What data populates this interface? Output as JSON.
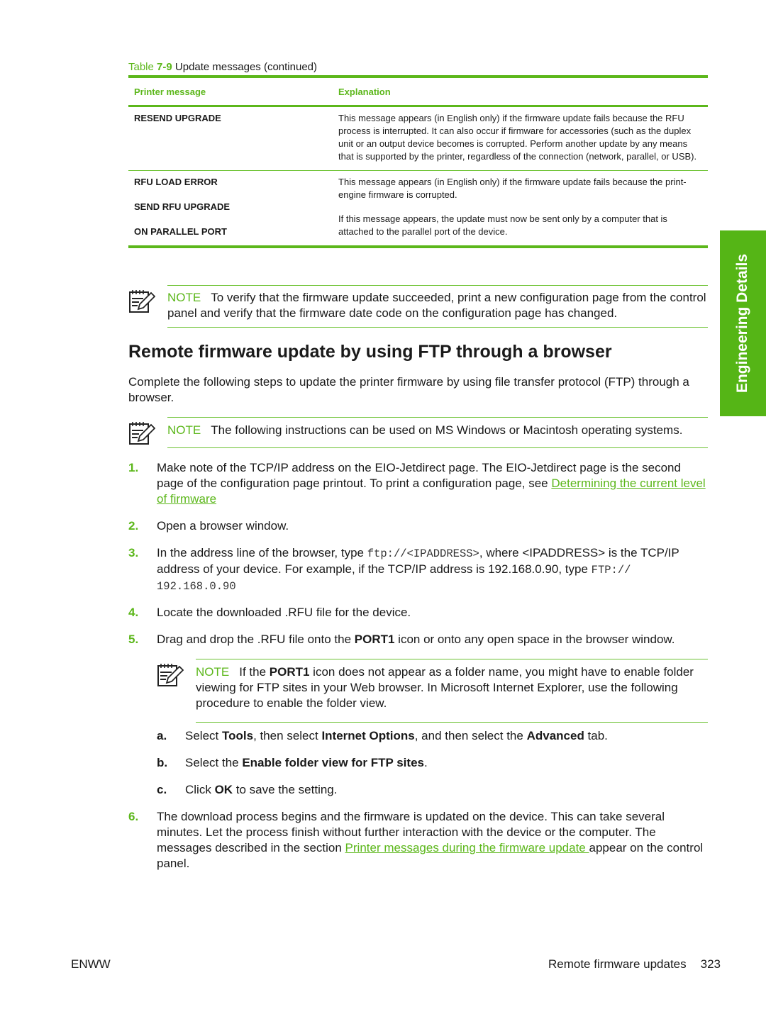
{
  "table": {
    "caption_prefix": "Table ",
    "caption_number": "7-9",
    "caption_text": "Update messages (continued)",
    "headers": [
      "Printer message",
      "Explanation"
    ],
    "rows": [
      {
        "messages": [
          "RESEND UPGRADE"
        ],
        "explanation": "This message appears (in English only) if the firmware update fails because the RFU process is interrupted. It can also occur if firmware for accessories (such as the duplex unit or an output device becomes is corrupted. Perform another update by any means that is supported by the printer, regardless of the connection (network, parallel, or USB)."
      },
      {
        "messages": [
          "RFU LOAD ERROR",
          "SEND RFU UPGRADE",
          "ON PARALLEL PORT"
        ],
        "explanation": "This message appears (in English only) if the firmware update fails because the print-engine firmware is corrupted.",
        "explanation2": "If this message appears, the update must now be sent only by a computer that is attached to the parallel port of the device."
      }
    ]
  },
  "side_tab": {
    "label": "Engineering Details",
    "color": "#55b516"
  },
  "note1": {
    "label": "NOTE",
    "text": "To verify that the firmware update succeeded, print a new configuration page from the control panel and verify that the firmware date code on the configuration page has changed."
  },
  "section": {
    "title": "Remote firmware update by using FTP through a browser",
    "intro": "Complete the following steps to update the printer firmware by using file transfer protocol (FTP) through a browser."
  },
  "note2": {
    "label": "NOTE",
    "text": "The following instructions can be used on MS Windows or Macintosh operating systems."
  },
  "steps": [
    {
      "num": "1.",
      "text": "Make note of the TCP/IP address on the EIO-Jetdirect page. The EIO-Jetdirect page is the second page of the configuration page printout. To print a configuration page, see ",
      "link": "Determining the current level of firmware"
    },
    {
      "num": "2.",
      "text": "Open a browser window."
    },
    {
      "num": "3.",
      "text_a": "In the address line of the browser, type ",
      "code_a": "ftp://<IPADDRESS>",
      "text_b": ", where <IPADDRESS> is the TCP/IP address of your device. For example, if the TCP/IP address is 192.168.0.90, type ",
      "code_b": "FTP:// 192.168.0.90"
    },
    {
      "num": "4.",
      "text": "Locate the downloaded .RFU file for the device."
    },
    {
      "num": "5.",
      "text_a": "Drag and drop the .RFU file onto the ",
      "bold": "PORT1",
      "text_b": " icon or onto any open space in the browser window."
    },
    {
      "num": "6.",
      "text_a": "The download process begins and the firmware is updated on the device. This can take several minutes. Let the process finish without further interaction with the device or the computer. The messages described in the section ",
      "link": "Printer messages during the firmware update ",
      "text_b": " appear on the control panel."
    }
  ],
  "note3": {
    "label": "NOTE",
    "text_a": "If the ",
    "bold": "PORT1",
    "text_b": " icon does not appear as a folder name, you might have to enable folder viewing for FTP sites in your Web browser. In Microsoft Internet Explorer, use the following procedure to enable the folder view."
  },
  "substeps": [
    {
      "num": "a.",
      "t1": "Select ",
      "b1": "Tools",
      "t2": ", then select ",
      "b2": "Internet Options",
      "t3": ", and then select the ",
      "b3": "Advanced",
      "t4": " tab."
    },
    {
      "num": "b.",
      "t1": "Select the ",
      "b1": "Enable folder view for FTP sites",
      "t2": "."
    },
    {
      "num": "c.",
      "t1": "Click ",
      "b1": "OK",
      "t2": " to save the setting."
    }
  ],
  "footer": {
    "left": "ENWW",
    "section": "Remote firmware updates",
    "page": "323"
  },
  "colors": {
    "accent": "#5cb71b",
    "text": "#1a1a1a"
  }
}
